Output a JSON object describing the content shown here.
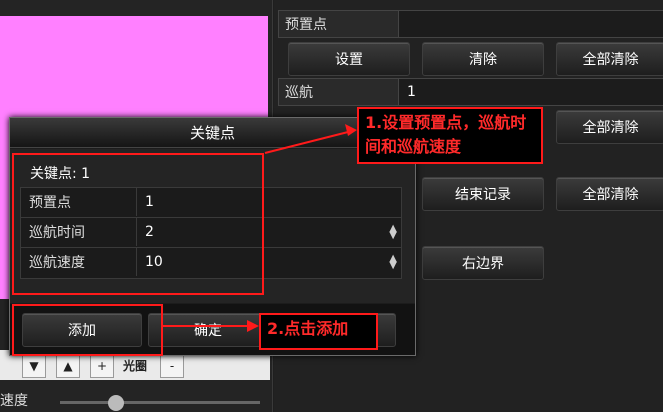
{
  "background": {
    "preset_header": "预置点",
    "preset_buttons": [
      "设置",
      "清除",
      "全部清除"
    ],
    "cruise_label": "巡航",
    "cruise_value": "1",
    "cruise_clear_all": "全部清除",
    "record_buttons": [
      "结束记录",
      "全部清除"
    ],
    "right_edge_button": "右边界",
    "ptz_controls": [
      "▼",
      "▲",
      "+",
      "光圈",
      "-"
    ],
    "speed_label": "速度"
  },
  "dialog": {
    "title": "关键点",
    "keypoint_label": "关键点: 1",
    "fields": [
      {
        "label": "预置点",
        "value": "1",
        "spinner": false
      },
      {
        "label": "巡航时间",
        "value": "2",
        "spinner": true
      },
      {
        "label": "巡航速度",
        "value": "10",
        "spinner": true
      }
    ],
    "add_button": "添加",
    "ok_button": "确定"
  },
  "annotations": {
    "step1": "1.设置预置点，巡航时间和巡航速度",
    "step2": "2.点击添加"
  },
  "colors": {
    "annotation": "#ff1a1a",
    "preview": "#ff80ff"
  }
}
